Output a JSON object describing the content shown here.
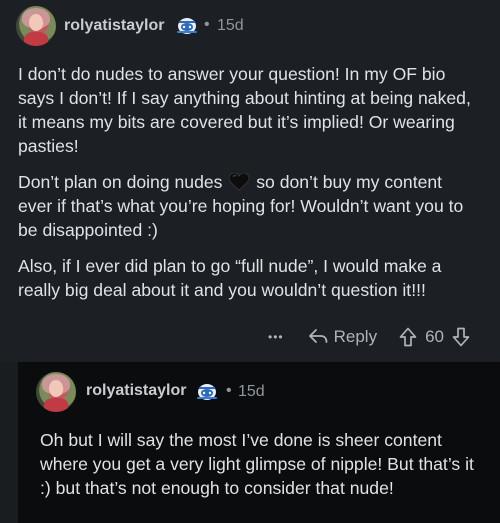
{
  "comments": [
    {
      "username": "rolyatistaylor",
      "separator": "•",
      "time": "15d",
      "paragraphs": [
        "I don’t do nudes to answer your question! In my OF bio says I don’t! If I say anything about hinting at being naked, it means my bits are covered but it’s implied! Or wearing pasties!",
        "Don’t plan on doing nudes",
        "so don’t buy my content ever if that’s what you’re hoping for! Wouldn’t want you to be disappointed :)",
        "Also, if I ever did plan to go “full nude”, I would make a really big deal about it and you wouldn’t question it!!!"
      ],
      "heart_emoji": "black-heart",
      "more_label": "•••",
      "reply_label": "Reply",
      "score": "60"
    },
    {
      "username": "rolyatistaylor",
      "separator": "•",
      "time": "15d",
      "paragraphs": [
        "Oh but I will say the most I’ve done is sheer content where you get a very light glimpse of nipple! But that’s it :) but that’s not enough to consider that nude!"
      ]
    }
  ],
  "colors": {
    "background": "#1c1f23",
    "nested_background": "#0b0c0d",
    "text": "#dfe3e6",
    "meta": "#8e979d"
  }
}
